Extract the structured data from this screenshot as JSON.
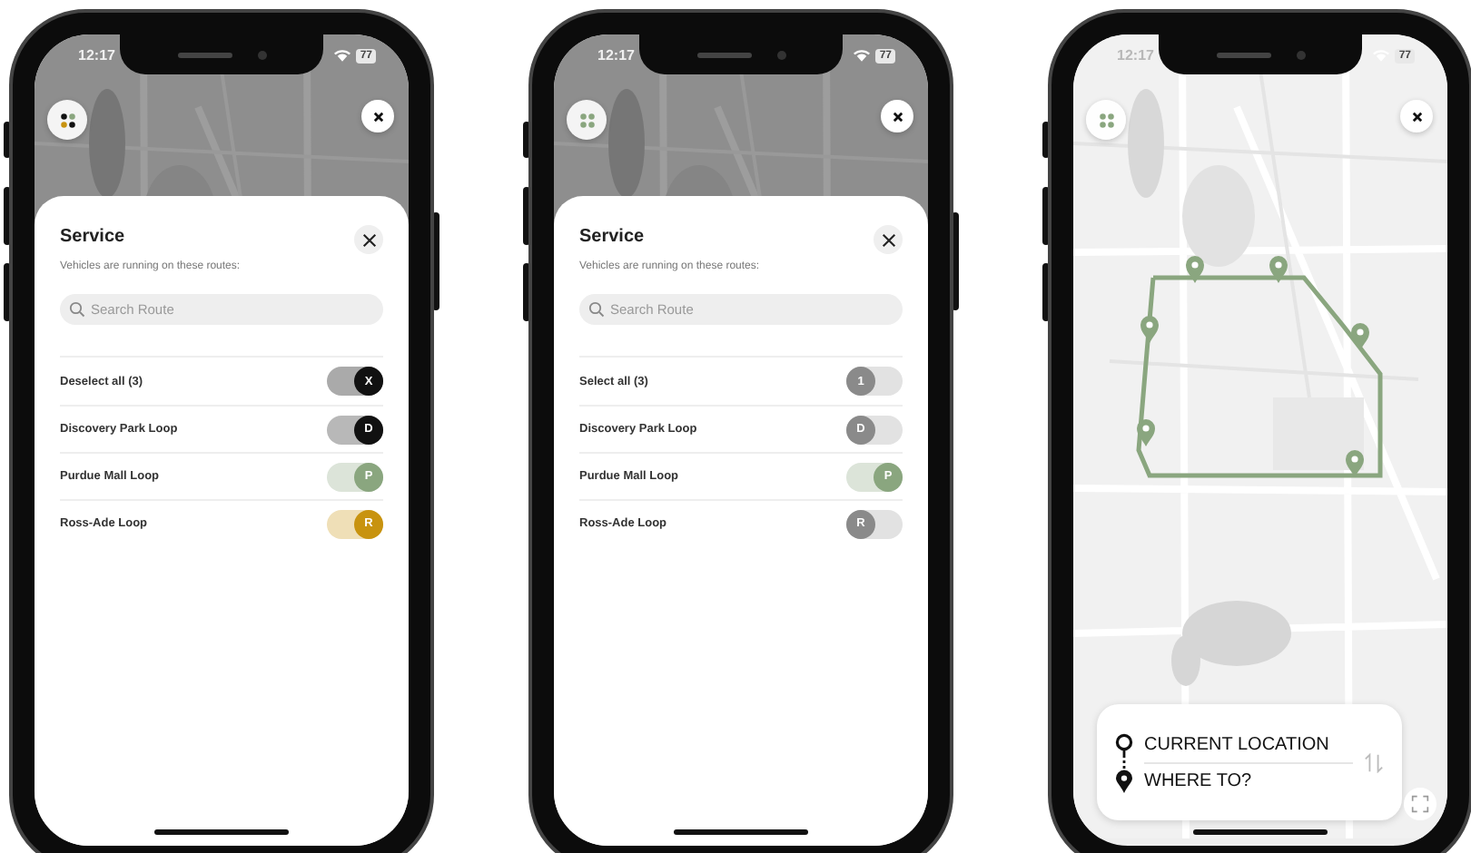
{
  "phones": [
    {
      "kind": "service_sheet",
      "status_bar": {
        "time": "12:17",
        "battery": "77"
      },
      "sheet": {
        "title": "Service",
        "subtitle": "Vehicles are running on these routes:",
        "search": {
          "placeholder": "Search Route"
        },
        "toggle_all": {
          "label": "Deselect all (3)",
          "knob": "X",
          "on": true
        },
        "routes": [
          {
            "name": "Discovery Park Loop",
            "badge": "D",
            "color": "#111111",
            "on": true
          },
          {
            "name": "Purdue Mall Loop",
            "badge": "P",
            "color": "#8aa67f",
            "on": true
          },
          {
            "name": "Ross-Ade Loop",
            "badge": "R",
            "color": "#c8930f",
            "on": true
          }
        ]
      }
    },
    {
      "kind": "service_sheet",
      "status_bar": {
        "time": "12:17",
        "battery": "77"
      },
      "sheet": {
        "title": "Service",
        "subtitle": "Vehicles are running on these routes:",
        "search": {
          "placeholder": "Search Route"
        },
        "toggle_all": {
          "label": "Select all (3)",
          "knob": "1",
          "on": false
        },
        "routes": [
          {
            "name": "Discovery Park Loop",
            "badge": "D",
            "on": false
          },
          {
            "name": "Purdue Mall Loop",
            "badge": "P",
            "color": "#8aa67f",
            "on": true
          },
          {
            "name": "Ross-Ade Loop",
            "badge": "R",
            "on": false
          }
        ]
      }
    },
    {
      "kind": "map",
      "status_bar": {
        "time": "12:17",
        "battery": "77"
      },
      "trip_card": {
        "origin": "CURRENT LOCATION",
        "destination": "WHERE TO?"
      }
    }
  ]
}
